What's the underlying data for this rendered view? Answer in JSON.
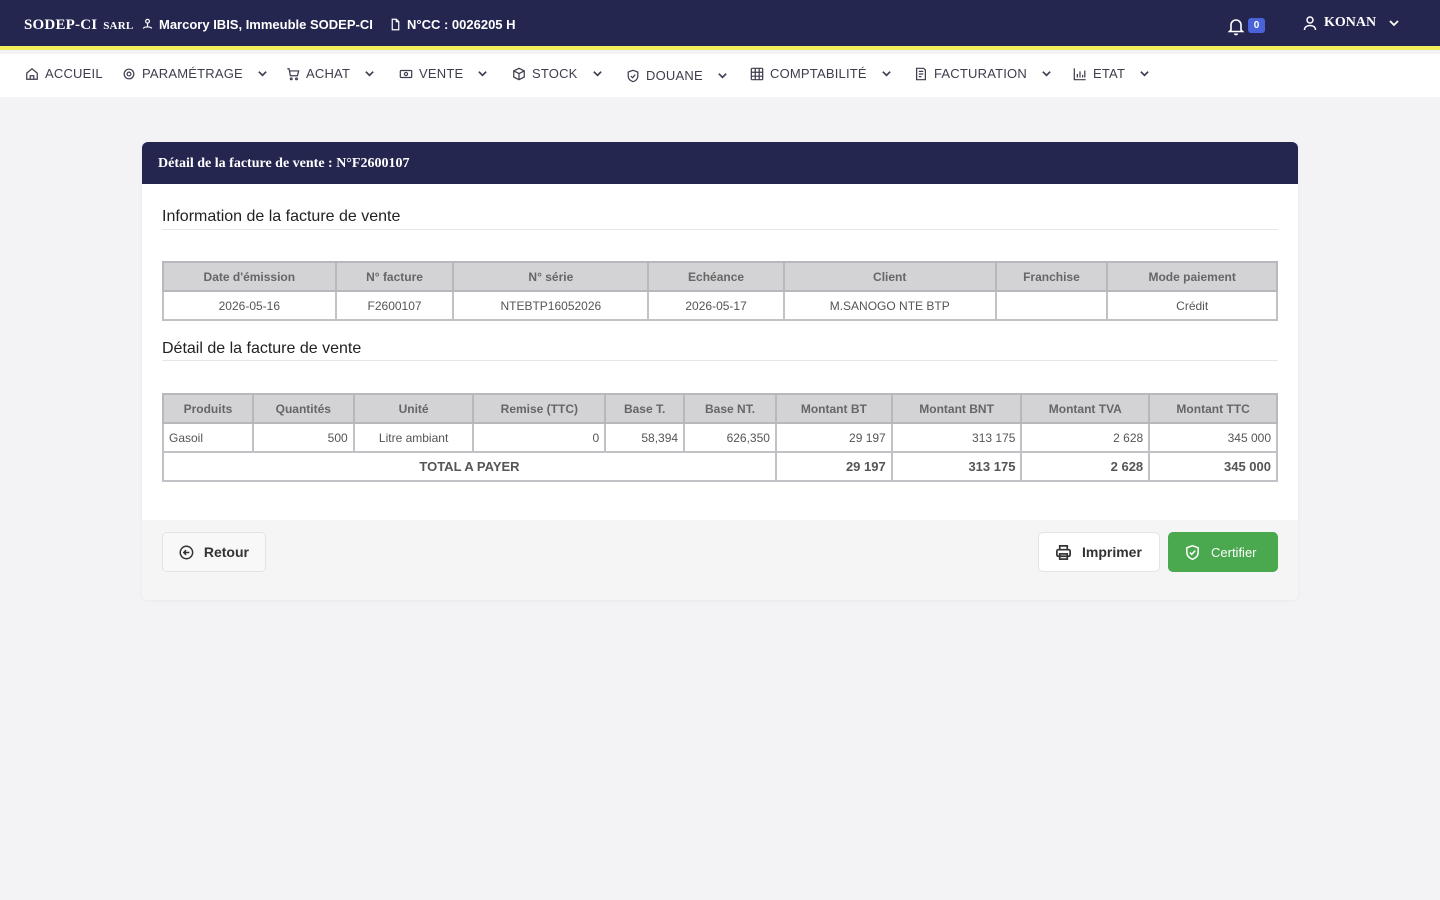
{
  "topbar": {
    "brand": "SODEP-CI",
    "brand_suffix": "SARL",
    "address": "Marcory IBIS, Immeuble SODEP-CI",
    "ncc": "N°CC : 0026205 H",
    "notification_count": "0",
    "username": "KONAN"
  },
  "nav": {
    "items": [
      {
        "label": "ACCUEIL",
        "icon": "home-icon"
      },
      {
        "label": "PARAMÉTRAGE",
        "icon": "gear-icon"
      },
      {
        "label": "ACHAT",
        "icon": "cart-icon"
      },
      {
        "label": "VENTE",
        "icon": "money-icon"
      },
      {
        "label": "STOCK",
        "icon": "box-icon"
      },
      {
        "label": "DOUANE",
        "icon": "shield-icon"
      },
      {
        "label": "COMPTABILITÉ",
        "icon": "grid-icon"
      },
      {
        "label": "FACTURATION",
        "icon": "invoice-icon"
      },
      {
        "label": "ETAT",
        "icon": "chart-icon"
      }
    ]
  },
  "card": {
    "title": "Détail de la facture de vente : N°F2600107",
    "info_title": "Information de la facture de vente",
    "info_headers": [
      "Date d'émission",
      "N° facture",
      "N° série",
      "Echéance",
      "Client",
      "Franchise",
      "Mode paiement"
    ],
    "info_row": [
      "2026-05-16",
      "F2600107",
      "NTEBTP16052026",
      "2026-05-17",
      "M.SANOGO NTE BTP",
      "",
      "Crédit"
    ],
    "detail_title": "Détail de la facture de vente",
    "detail_headers": [
      "Produits",
      "Quantités",
      "Unité",
      "Remise (TTC)",
      "Base T.",
      "Base NT.",
      "Montant BT",
      "Montant BNT",
      "Montant TVA",
      "Montant TTC"
    ],
    "detail_row": [
      "Gasoil",
      "500",
      "Litre ambiant",
      "0",
      "58,394",
      "626,350",
      "29 197",
      "313 175",
      "2 628",
      "345 000"
    ],
    "total_label": "TOTAL A PAYER",
    "totals": [
      "29 197",
      "313 175",
      "2 628",
      "345 000"
    ]
  },
  "buttons": {
    "back": "Retour",
    "print": "Imprimer",
    "certify": "Certifier"
  },
  "colors": {
    "header_bg": "#25264f",
    "accent_line": "#f2ee5a",
    "certify": "#4aa84e",
    "badge": "#4b63d8"
  }
}
